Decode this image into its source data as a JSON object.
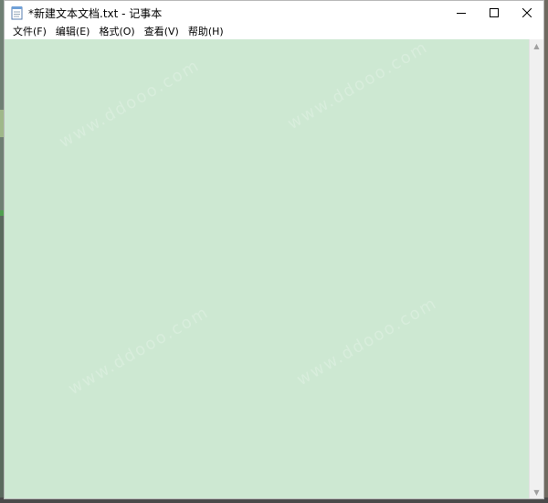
{
  "window": {
    "title": "*新建文本文档.txt - 记事本",
    "icon": "notepad-icon"
  },
  "controls": {
    "minimize_icon": "minimize-icon",
    "maximize_icon": "maximize-icon",
    "close_icon": "close-icon"
  },
  "menu": {
    "items": [
      {
        "label": "文件(F)"
      },
      {
        "label": "编辑(E)"
      },
      {
        "label": "格式(O)"
      },
      {
        "label": "查看(V)"
      },
      {
        "label": "帮助(H)"
      }
    ]
  },
  "editor": {
    "text": "",
    "background_color": "#cde8d2"
  },
  "watermark": {
    "text": "www.ddooo.com"
  }
}
